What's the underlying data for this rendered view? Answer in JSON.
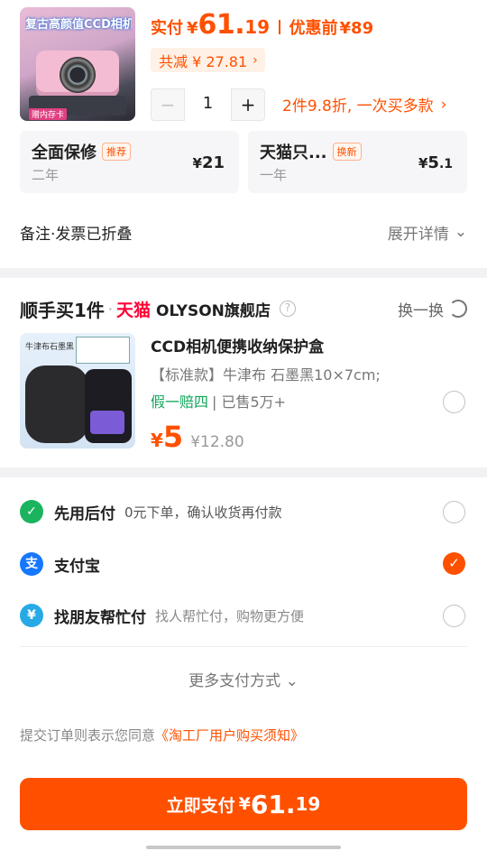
{
  "product": {
    "thumb_title": "复古高颜值CCD相机",
    "thumb_tag": "赠内存卡",
    "pay_label": "实付",
    "currency": "¥",
    "pay_int": "61.",
    "pay_dec": "19",
    "before_label": "优惠前",
    "before_value": "¥89",
    "discount_text": "共减 ¥ 27.81",
    "discount_chevron": "›",
    "quantity": "1",
    "minus": "−",
    "plus": "+",
    "promo_text": "2件9.8折, 一次买多款",
    "promo_chevron": "›"
  },
  "services": [
    {
      "name": "全面保修",
      "badge": "推荐",
      "sub": "二年",
      "currency": "¥",
      "price_int": "21",
      "price_dec": ""
    },
    {
      "name": "天猫只...",
      "badge": "换新",
      "sub": "一年",
      "currency": "¥",
      "price_int": "5",
      "price_dec": ".1"
    }
  ],
  "notes": {
    "label": "备注·发票已折叠",
    "action": "展开详情",
    "chevron": "⌄"
  },
  "addon": {
    "title": "顺手买1件",
    "dot": "·",
    "tmall": "天猫",
    "store": "OLYSON旗舰店",
    "help": "?",
    "swap": "换一换",
    "thumb_label": "牛津布石墨黑",
    "item_title": "CCD相机便携收纳保护盒",
    "item_sku": "【标准款】牛津布 石墨黑10×7cm;",
    "tag_guarantee": "假一赔四",
    "tag_sold": "| 已售5万+",
    "currency": "¥",
    "price_now": "5",
    "price_old": "¥12.80"
  },
  "payment_methods": [
    {
      "icon_glyph": "✓",
      "icon_color": "#1bb35e",
      "name": "先用后付",
      "desc": "0元下单，确认收货再付款",
      "desc_grey": false,
      "selected": false
    },
    {
      "icon_glyph": "支",
      "icon_color": "#1677ff",
      "name": "支付宝",
      "desc": "",
      "desc_grey": false,
      "selected": true
    },
    {
      "icon_glyph": "¥",
      "icon_color": "#27a9e6",
      "name": "找朋友帮忙付",
      "desc": "找人帮忙付，购物更方便",
      "desc_grey": true,
      "selected": false
    }
  ],
  "more_methods": "更多支付方式 ⌄",
  "agreement": {
    "prefix": "提交订单则表示您同意",
    "link": "《淘工厂用户购买须知》"
  },
  "pay_button": {
    "label": "立即支付",
    "currency": "¥",
    "int": "61.",
    "dec": "19"
  },
  "colors": {
    "accent": "#ff5000",
    "tmall": "#ff0036",
    "green": "#11a55a"
  }
}
